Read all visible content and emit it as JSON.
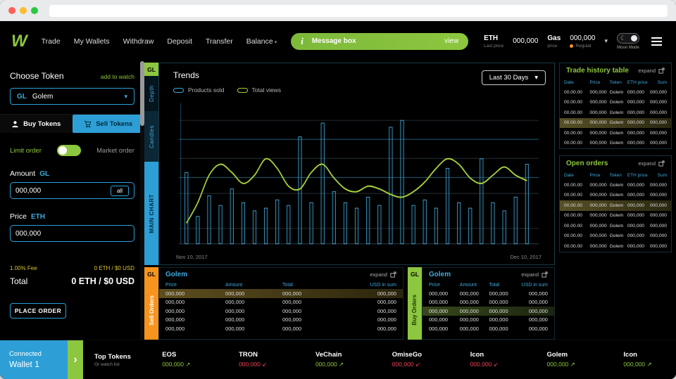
{
  "colors": {
    "green": "#8dc63f",
    "cyan": "#2d9fd6",
    "orange": "#f7941e",
    "red": "#ee4056",
    "highlight_olive": "#5d4e1e"
  },
  "icons": {
    "chevron_down": "▾",
    "trend_up": "↗",
    "trend_down": "↙",
    "moon": "☾",
    "arrow_right": "›",
    "info": "i"
  },
  "navbar": {
    "logo": "W",
    "links": [
      "Trade",
      "My Wallets",
      "Withdraw",
      "Deposit",
      "Transfer",
      "Balance"
    ],
    "message_box": {
      "icon": "i",
      "label": "Message box",
      "view_label": "view"
    },
    "eth": {
      "label": "ETH",
      "sublabel": "Last price",
      "value": "000,000"
    },
    "gas": {
      "label": "Gas",
      "sublabel": "price",
      "value": "000,000",
      "mode": "Regular"
    },
    "moon_mode_label": "Moon Mode"
  },
  "sidebar": {
    "choose_token_label": "Choose Token",
    "add_to_watch_label": "add to watch",
    "token_select": {
      "symbol": "GL",
      "name": "Golem"
    },
    "buy_tab_label": "Buy Tokens",
    "sell_tab_label": "Sell Tokens",
    "limit_order_label": "Limit order",
    "market_order_label": "Market order",
    "amount_label": "Amount",
    "amount_unit": "GL",
    "amount_value": "000,000",
    "all_button_label": "all",
    "price_label": "Price",
    "price_unit": "ETH",
    "price_value": "000,000",
    "fee_label": "1.00% Fee",
    "fee_value": "0 ETH / $0 USD",
    "total_label": "Total",
    "total_value": "0 ETH / $0 USD",
    "place_order_label": "PLACE ORDER"
  },
  "chart_strip": {
    "token": "GL",
    "tabs": [
      "Depth",
      "Candles",
      "MAIN CHART"
    ]
  },
  "chart_data": {
    "type": "bar+line",
    "title": "Trends",
    "range_label": "Last 30 Days",
    "x_start_label": "Nov 10, 2017",
    "x_end_label": "Dec 10, 2017",
    "ylim": [
      0,
      100
    ],
    "grid": true,
    "legend_position": "top-left",
    "series": [
      {
        "name": "Products sold",
        "type": "bar",
        "color": "#3fa9dc",
        "values": [
          52,
          20,
          35,
          28,
          40,
          30,
          24,
          26,
          32,
          28,
          78,
          30,
          88,
          38,
          30,
          26,
          34,
          28,
          85,
          90,
          28,
          32,
          26,
          55,
          30,
          26,
          62,
          30,
          24,
          34,
          58
        ]
      },
      {
        "name": "Total views",
        "type": "line",
        "color": "#a6ce39",
        "values": [
          15,
          30,
          50,
          58,
          52,
          44,
          50,
          62,
          55,
          42,
          40,
          52,
          58,
          48,
          40,
          38,
          42,
          40,
          36,
          34,
          38,
          45,
          55,
          62,
          58,
          48,
          44,
          50,
          56,
          50,
          46
        ]
      }
    ]
  },
  "sell_orders": {
    "token": "GL",
    "strip_label": "Sell Orders",
    "title": "Golem",
    "expand_label": "expand",
    "columns": [
      "Price",
      "Amount",
      "Total",
      "USD in sum"
    ],
    "rows": [
      [
        "000,000",
        "000,000",
        "000,000",
        "000,000"
      ],
      [
        "000,000",
        "000,000",
        "000,000",
        "000,000"
      ],
      [
        "000,000",
        "000,000",
        "000,000",
        "000,000"
      ],
      [
        "000,000",
        "000,000",
        "000,000",
        "000,000"
      ],
      [
        "000,000",
        "000,000",
        "000,000",
        "000,000"
      ]
    ],
    "highlight_row": 0
  },
  "buy_orders": {
    "token": "GL",
    "strip_label": "Buy Orders",
    "title": "Golem",
    "expand_label": "expand",
    "columns": [
      "Price",
      "Amount",
      "Total",
      "USD in sum"
    ],
    "rows": [
      [
        "000,000",
        "000,000",
        "000,000",
        "000,000"
      ],
      [
        "000,000",
        "000,000",
        "000,000",
        "000,000"
      ],
      [
        "000,000",
        "000,000",
        "000,000",
        "000,000"
      ],
      [
        "000,000",
        "000,000",
        "000,000",
        "000,000"
      ],
      [
        "000,000",
        "000,000",
        "000,000",
        "000,000"
      ]
    ],
    "highlight_row": 2
  },
  "trade_history": {
    "title": "Trade history table",
    "expand_label": "expand",
    "columns": [
      "Date",
      "Price",
      "Token",
      "ETH price",
      "Sum"
    ],
    "rows": [
      [
        "00.00.00",
        "000,000",
        "Golem",
        "000,000",
        "000,000"
      ],
      [
        "00.00.00",
        "000,000",
        "Golem",
        "000,000",
        "000,000"
      ],
      [
        "00.00.00",
        "000,000",
        "Golem",
        "000,000",
        "000,000"
      ],
      [
        "00.00.00",
        "000,000",
        "Golem",
        "000,000",
        "000,000"
      ],
      [
        "00.00.00",
        "000,000",
        "Golem",
        "000,000",
        "000,000"
      ],
      [
        "00.00.00",
        "000,000",
        "Golem",
        "000,000",
        "000,000"
      ]
    ],
    "highlight_row": 3
  },
  "open_orders": {
    "title": "Open orders",
    "expand_label": "expand",
    "columns": [
      "Date",
      "Price",
      "Token",
      "ETH price",
      "Sum"
    ],
    "rows": [
      [
        "00.00.00",
        "000,000",
        "Golem",
        "000,000",
        "000,000"
      ],
      [
        "00.00.00",
        "000,000",
        "Golem",
        "000,000",
        "000,000"
      ],
      [
        "00.00.00",
        "000,000",
        "Golem",
        "000,000",
        "000,000"
      ],
      [
        "00.00.00",
        "000,000",
        "Golem",
        "000,000",
        "000,000"
      ],
      [
        "00.00.00",
        "000,000",
        "Golem",
        "000,000",
        "000,000"
      ],
      [
        "00.00.00",
        "000,000",
        "Golem",
        "000,000",
        "000,000"
      ],
      [
        "00.00.00",
        "000,000",
        "Golem",
        "000,000",
        "000,000"
      ]
    ],
    "highlight_row": 2
  },
  "ticker": {
    "connected_label": "Connected",
    "wallet_label": "Wallet 1",
    "top_tokens_label": "Top Tokens",
    "watch_list_label": "Or watch list",
    "tokens": [
      {
        "name": "EOS",
        "value": "000,000",
        "trend": "up"
      },
      {
        "name": "TRON",
        "value": "000,000",
        "trend": "down"
      },
      {
        "name": "VeChain",
        "value": "000,000",
        "trend": "up"
      },
      {
        "name": "OmiseGo",
        "value": "000,000",
        "trend": "down"
      },
      {
        "name": "Icon",
        "value": "000,000",
        "trend": "down"
      },
      {
        "name": "Golem",
        "value": "000,000",
        "trend": "up"
      },
      {
        "name": "Icon",
        "value": "000,000",
        "trend": "up"
      }
    ]
  }
}
